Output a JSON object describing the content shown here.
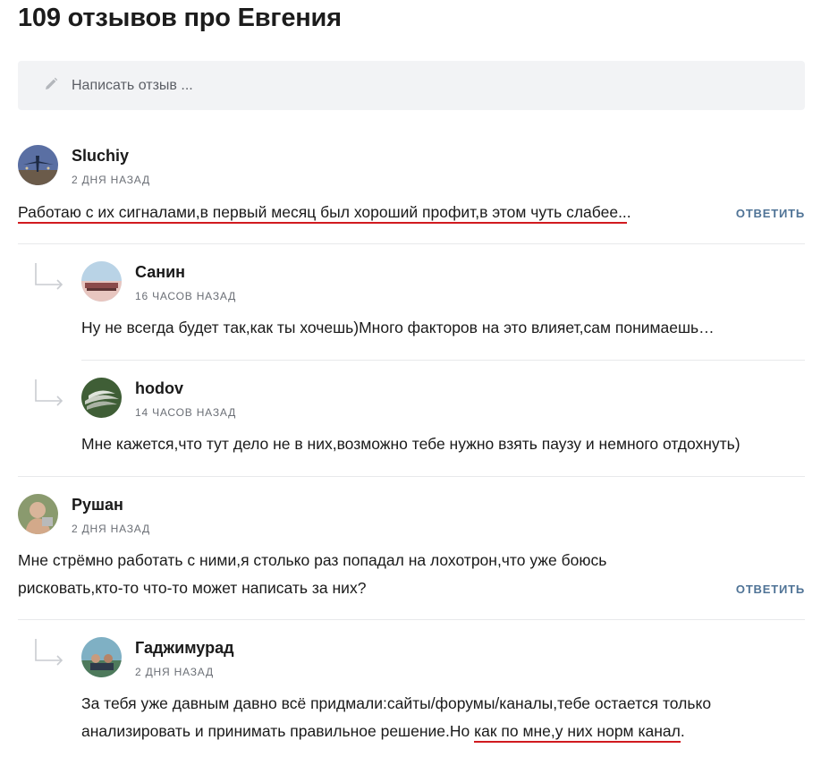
{
  "page": {
    "title": "109 отзывов про Евгения"
  },
  "composer": {
    "placeholder": "Написать отзыв ..."
  },
  "reply_label": "ОТВЕТИТЬ",
  "comments": [
    {
      "author": "Sluchiy",
      "time": "2 ДНЯ НАЗАД",
      "text_marked": "Работаю с их сигналами,в первый месяц был хороший профит,в этом чуть слабее..",
      "text_rest": ".",
      "replies": [
        {
          "author": "Санин",
          "time": "16 ЧАСОВ НАЗАД",
          "text": "Ну не всегда будет так,как ты хочешь)Много факторов на это влияет,сам понимаешь…"
        },
        {
          "author": "hodov",
          "time": "14 ЧАСОВ НАЗАД",
          "text": "Мне кажется,что тут дело не в них,возможно тебе нужно взять паузу и немного отдохнуть)"
        }
      ]
    },
    {
      "author": "Рушан",
      "time": "2 ДНЯ НАЗАД",
      "text_line1": "Мне стрёмно работать с ними,я столько раз попадал на лохотрон,что уже боюсь",
      "text_line2": "рисковать,кто-то что-то может написать за них?",
      "replies": [
        {
          "author": "Гаджимурад",
          "time": "2 ДНЯ НАЗАД",
          "text_line1": "За тебя уже давным давно всё придмали:сайты/форумы/каналы,тебе остается только",
          "text_line2_plain": "анализировать и принимать правильное решение.Но ",
          "text_line2_marked": "как по мне,у них норм канал",
          "text_line2_end": "."
        }
      ]
    }
  ]
}
